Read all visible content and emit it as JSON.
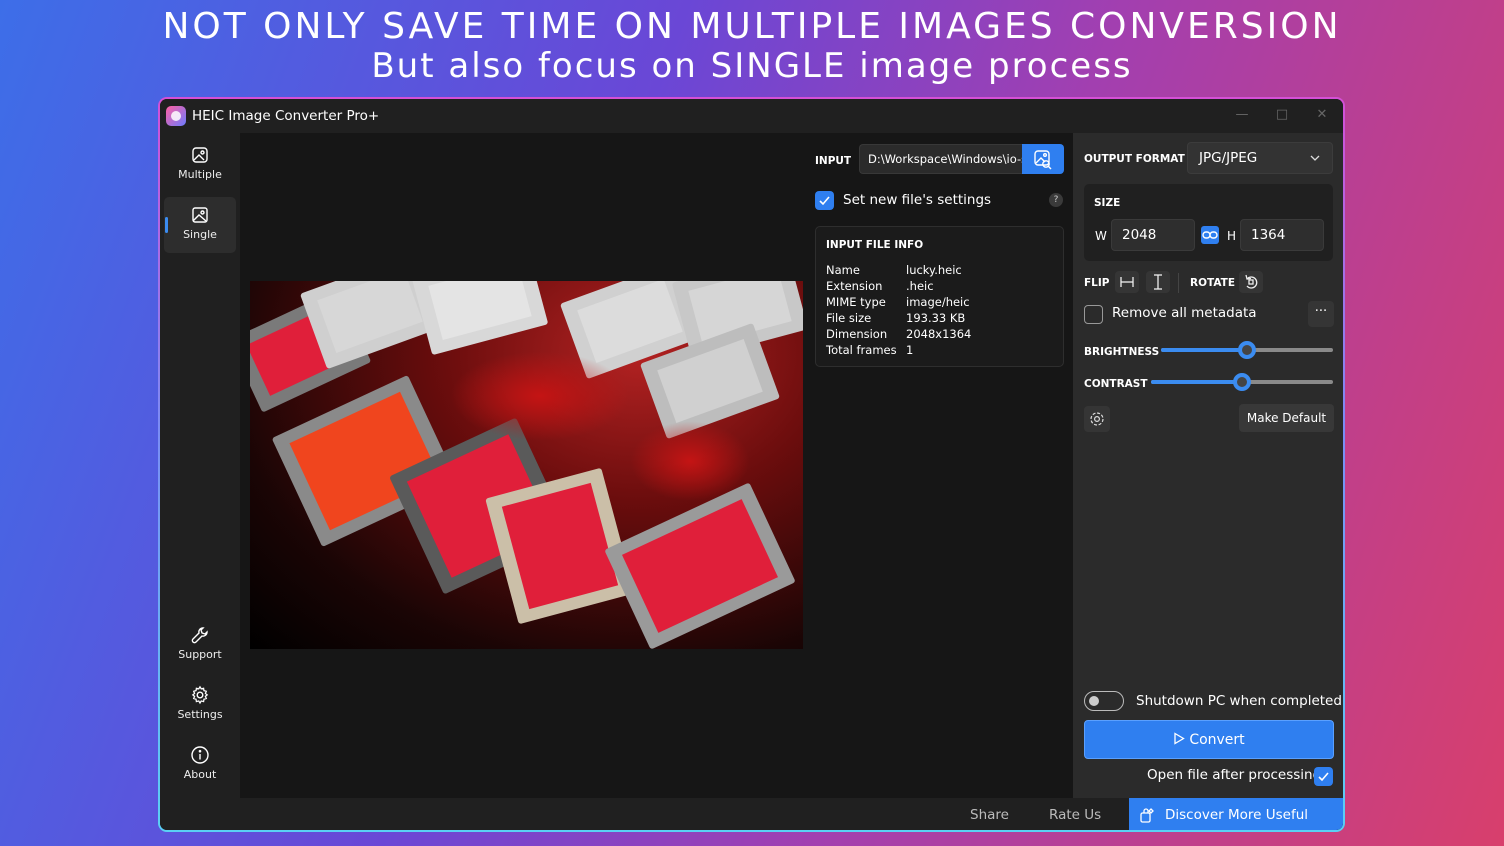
{
  "promo": {
    "headline": "NOT ONLY SAVE TIME ON MULTIPLE IMAGES CONVERSION",
    "subheadline": "But also focus on SINGLE image process"
  },
  "window": {
    "title": "HEIC Image Converter Pro+",
    "controls": [
      "minimize-icon",
      "maximize-icon",
      "close-icon"
    ]
  },
  "sidebar": {
    "top_items": [
      {
        "label": "Multiple",
        "icon": "images-icon",
        "active": false
      },
      {
        "label": "Single",
        "icon": "image-icon",
        "active": true
      }
    ],
    "bottom_items": [
      {
        "label": "Support",
        "icon": "wrench-icon"
      },
      {
        "label": "Settings",
        "icon": "gear-icon"
      },
      {
        "label": "About",
        "icon": "info-icon"
      }
    ]
  },
  "input": {
    "label": "INPUT",
    "path": "D:\\Workspace\\Windows\\io-st",
    "settings_checkbox_label": "Set new file's settings",
    "settings_checked": true,
    "help": "?"
  },
  "file_info": {
    "title": "INPUT FILE INFO",
    "rows": [
      {
        "key": "Name",
        "value": "lucky.heic"
      },
      {
        "key": "Extension",
        "value": ".heic"
      },
      {
        "key": "MIME type",
        "value": "image/heic"
      },
      {
        "key": "File size",
        "value": "193.33 KB"
      },
      {
        "key": "Dimension",
        "value": "2048x1364"
      },
      {
        "key": "Total frames",
        "value": "1"
      }
    ]
  },
  "output": {
    "format_label": "OUTPUT FORMAT",
    "format_value": "JPG/JPEG",
    "size_label": "SIZE",
    "width_label": "W",
    "width_value": "2048",
    "height_label": "H",
    "height_value": "1364",
    "flip_label": "FLIP",
    "rotate_label": "ROTATE",
    "metadata_label": "Remove all metadata",
    "metadata_checked": false,
    "more_label": "···",
    "brightness_label": "BRIGHTNESS",
    "brightness_value": 0.5,
    "contrast_label": "CONTRAST",
    "contrast_value": 0.5,
    "make_default_label": "Make Default",
    "shutdown_label": "Shutdown PC when completed",
    "shutdown_on": false,
    "convert_label": "Convert",
    "open_after_label": "Open file after processing",
    "open_after_checked": true
  },
  "footer": {
    "share_label": "Share",
    "rate_label": "Rate Us",
    "discover_label": "Discover More Useful Apps"
  },
  "colors": {
    "accent": "#2f7ff0",
    "window_bg": "#202020",
    "preview_bg": "#161616",
    "settings_bg": "#2b2b2b"
  }
}
